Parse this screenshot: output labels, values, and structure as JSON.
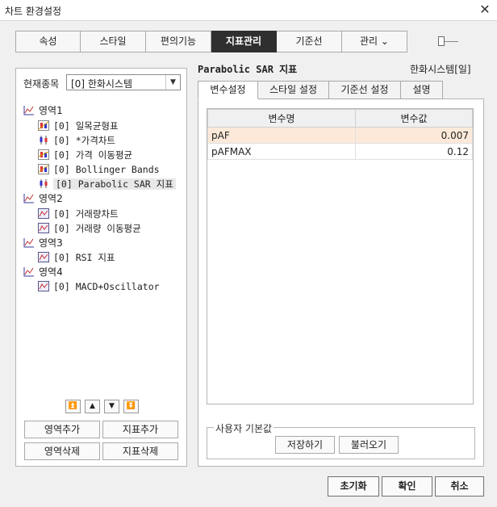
{
  "window": {
    "title": "차트 환경설정",
    "close": "✕"
  },
  "tabs": [
    {
      "label": "속성"
    },
    {
      "label": "스타일"
    },
    {
      "label": "편의기능"
    },
    {
      "label": "지표관리"
    },
    {
      "label": "기준선"
    },
    {
      "label": "관리 ⌄"
    }
  ],
  "left": {
    "current_label": "현재종목",
    "current_value": "[0] 한화시스템",
    "tree": [
      {
        "label": "영역1"
      },
      {
        "label": "[0] 일목균형표"
      },
      {
        "label": "[0] *가격차트"
      },
      {
        "label": "[0] 가격 이동평균"
      },
      {
        "label": "[0] Bollinger Bands"
      },
      {
        "label": "[0] Parabolic SAR 지표"
      },
      {
        "label": "영역2"
      },
      {
        "label": "[0] 거래량차트"
      },
      {
        "label": "[0] 거래량 이동평균"
      },
      {
        "label": "영역3"
      },
      {
        "label": "[0] RSI 지표"
      },
      {
        "label": "영역4"
      },
      {
        "label": "[0] MACD+Oscillator"
      }
    ],
    "move_buttons": {
      "top": "⏫",
      "up": "▲",
      "down": "▼",
      "bottom": "⏬"
    },
    "buttons": {
      "add_area": "영역추가",
      "add_indicator": "지표추가",
      "delete_area": "영역삭제",
      "delete_indicator": "지표삭제"
    }
  },
  "right": {
    "indicator_title": "Parabolic SAR 지표",
    "stock_name": "한화시스템[일]",
    "subtabs": [
      {
        "label": "변수설정"
      },
      {
        "label": "스타일 설정"
      },
      {
        "label": "기준선 설정"
      },
      {
        "label": "설명"
      }
    ],
    "grid": {
      "headers": [
        "변수명",
        "변수값"
      ],
      "rows": [
        {
          "name": "pAF",
          "value": "0.007"
        },
        {
          "name": "pAFMAX",
          "value": "0.12"
        }
      ]
    },
    "user_default": {
      "label": "사용자 기본값",
      "save": "저장하기",
      "load": "불러오기"
    }
  },
  "footer": {
    "reset": "초기화",
    "ok": "확인",
    "cancel": "취소"
  },
  "colors": {
    "active_tab": "#2f2f2f",
    "highlight_row": "#fde9d9"
  }
}
